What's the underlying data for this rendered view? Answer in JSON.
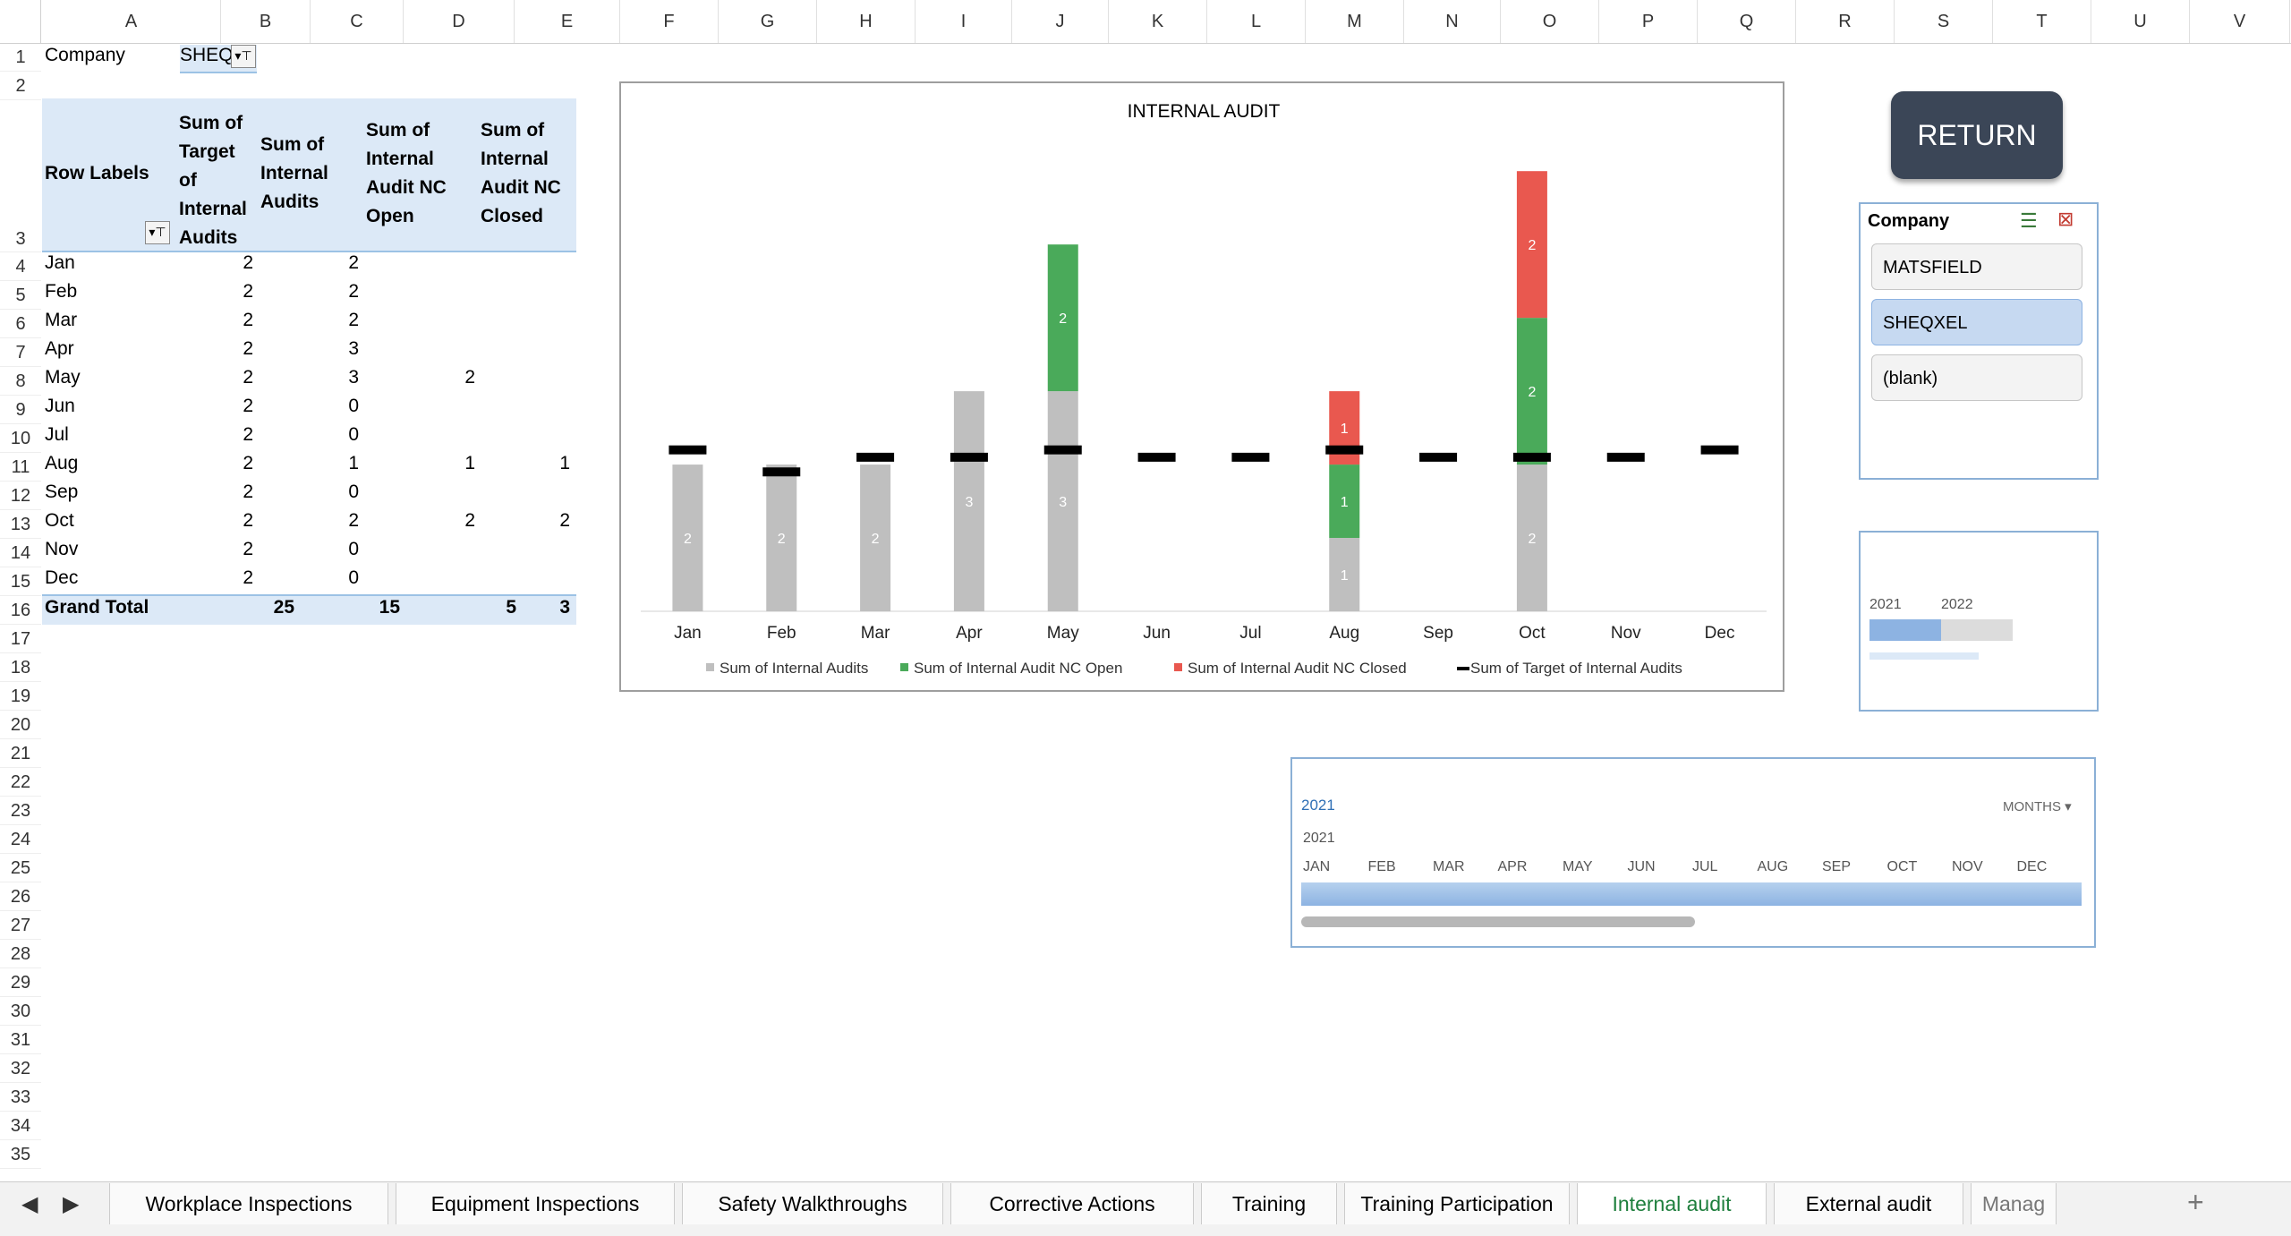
{
  "columns": [
    "A",
    "B",
    "C",
    "D",
    "E",
    "F",
    "G",
    "H",
    "I",
    "J",
    "K",
    "L",
    "M",
    "N",
    "O",
    "P",
    "Q",
    "R",
    "S",
    "T",
    "U",
    "V"
  ],
  "rows": [
    "1",
    "2",
    "3",
    "4",
    "5",
    "6",
    "7",
    "8",
    "9",
    "10",
    "11",
    "12",
    "13",
    "14",
    "15",
    "16",
    "17",
    "18",
    "19",
    "20",
    "21",
    "22",
    "23",
    "24",
    "25",
    "26",
    "27",
    "28",
    "29",
    "30",
    "31",
    "32",
    "33",
    "34",
    "35"
  ],
  "filter": {
    "label": "Company",
    "value": "SHEQ"
  },
  "pivot": {
    "headers": {
      "row_labels": "Row Labels",
      "target": [
        "Sum of",
        "Target",
        "of",
        "Internal",
        "Audits"
      ],
      "audits": [
        "Sum of",
        "Internal",
        "Audits"
      ],
      "nc_open": [
        "Sum of",
        "Internal",
        "Audit NC",
        "Open"
      ],
      "nc_closed": [
        "Sum of",
        "Internal",
        "Audit NC",
        "Closed"
      ]
    },
    "rows": [
      {
        "label": "Jan",
        "target": "2",
        "audits": "2",
        "nc_open": "",
        "nc_closed": ""
      },
      {
        "label": "Feb",
        "target": "2",
        "audits": "2",
        "nc_open": "",
        "nc_closed": ""
      },
      {
        "label": "Mar",
        "target": "2",
        "audits": "2",
        "nc_open": "",
        "nc_closed": ""
      },
      {
        "label": "Apr",
        "target": "2",
        "audits": "3",
        "nc_open": "",
        "nc_closed": ""
      },
      {
        "label": "May",
        "target": "2",
        "audits": "3",
        "nc_open": "2",
        "nc_closed": ""
      },
      {
        "label": "Jun",
        "target": "2",
        "audits": "0",
        "nc_open": "",
        "nc_closed": ""
      },
      {
        "label": "Jul",
        "target": "2",
        "audits": "0",
        "nc_open": "",
        "nc_closed": ""
      },
      {
        "label": "Aug",
        "target": "2",
        "audits": "1",
        "nc_open": "1",
        "nc_closed": "1"
      },
      {
        "label": "Sep",
        "target": "2",
        "audits": "0",
        "nc_open": "",
        "nc_closed": ""
      },
      {
        "label": "Oct",
        "target": "2",
        "audits": "2",
        "nc_open": "2",
        "nc_closed": "2"
      },
      {
        "label": "Nov",
        "target": "2",
        "audits": "0",
        "nc_open": "",
        "nc_closed": ""
      },
      {
        "label": "Dec",
        "target": "2",
        "audits": "0",
        "nc_open": "",
        "nc_closed": ""
      }
    ],
    "grand_total": {
      "label": "Grand Total",
      "target": "25",
      "audits": "15",
      "nc_open": "5",
      "nc_closed": "3"
    }
  },
  "chart_data": {
    "type": "bar",
    "title": "INTERNAL AUDIT",
    "categories": [
      "Jan",
      "Feb",
      "Mar",
      "Apr",
      "May",
      "Jun",
      "Jul",
      "Aug",
      "Sep",
      "Oct",
      "Nov",
      "Dec"
    ],
    "series": [
      {
        "name": "Sum of Internal Audits",
        "color": "#bfbfbf",
        "values": [
          2,
          2,
          2,
          3,
          3,
          0,
          0,
          1,
          0,
          2,
          0,
          0
        ]
      },
      {
        "name": "Sum of Internal Audit NC Open",
        "color": "#4aaa5a",
        "values": [
          0,
          0,
          0,
          0,
          2,
          0,
          0,
          1,
          0,
          2,
          0,
          0
        ]
      },
      {
        "name": "Sum of Internal Audit NC Closed",
        "color": "#e9584f",
        "values": [
          0,
          0,
          0,
          0,
          0,
          0,
          0,
          1,
          0,
          2,
          0,
          0
        ]
      },
      {
        "name": "Sum of Target of Internal Audits",
        "color": "#000000",
        "type": "marker",
        "values": [
          2.2,
          1.9,
          2.1,
          2.1,
          2.2,
          2.1,
          2.1,
          2.2,
          2.1,
          2.1,
          2.1,
          2.2
        ]
      }
    ],
    "ylim": [
      0,
      6.1
    ],
    "legend": "bottom",
    "grid": false
  },
  "return_button": "RETURN",
  "slicer": {
    "title": "Company",
    "items": [
      {
        "label": "MATSFIELD",
        "selected": false
      },
      {
        "label": "SHEQXEL",
        "selected": true
      },
      {
        "label": "(blank)",
        "selected": false
      }
    ]
  },
  "mini_slicer": {
    "years": [
      "2021",
      "2022"
    ]
  },
  "timeline": {
    "year": "2021",
    "sub_year": "2021",
    "level": "MONTHS",
    "months": [
      "JAN",
      "FEB",
      "MAR",
      "APR",
      "MAY",
      "JUN",
      "JUL",
      "AUG",
      "SEP",
      "OCT",
      "NOV",
      "DEC"
    ]
  },
  "tabs": [
    {
      "label": "Workplace Inspections",
      "active": false
    },
    {
      "label": "Equipment Inspections",
      "active": false
    },
    {
      "label": "Safety Walkthroughs",
      "active": false
    },
    {
      "label": "Corrective Actions",
      "active": false
    },
    {
      "label": "Training",
      "active": false
    },
    {
      "label": "Training Participation",
      "active": false
    },
    {
      "label": "Internal audit",
      "active": true
    },
    {
      "label": "External audit",
      "active": false
    },
    {
      "label": "Manag",
      "active": false
    }
  ],
  "add_sheet": "+"
}
